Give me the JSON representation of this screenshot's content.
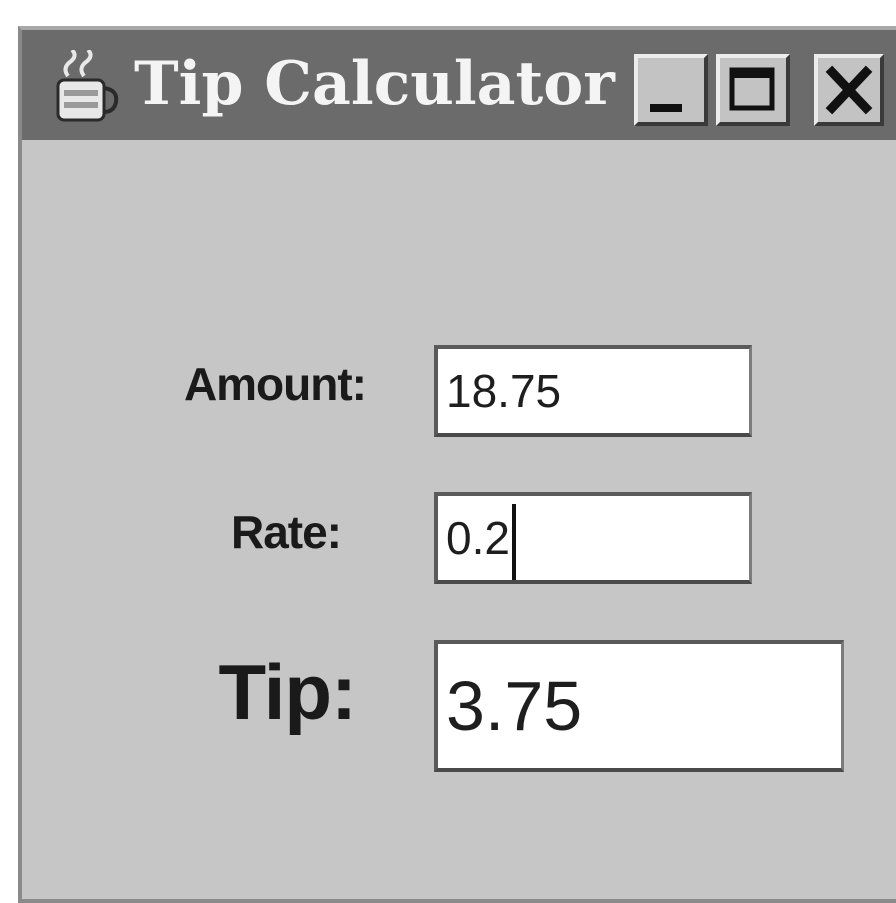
{
  "window": {
    "title": "Tip Calculator",
    "app_icon": "coffee-cup-icon",
    "controls": {
      "minimize_icon": "minimize-icon",
      "maximize_icon": "maximize-icon",
      "close_icon": "close-icon"
    }
  },
  "form": {
    "amount_label": "Amount:",
    "amount_value": "18.75",
    "rate_label": "Rate:",
    "rate_value": "0.2",
    "tip_label": "Tip:",
    "tip_value": "3.75"
  },
  "colors": {
    "titlebar": "#6b6b6b",
    "window_bg": "#c6c6c6",
    "field_bg": "#ffffff",
    "text": "#1a1a1a"
  }
}
